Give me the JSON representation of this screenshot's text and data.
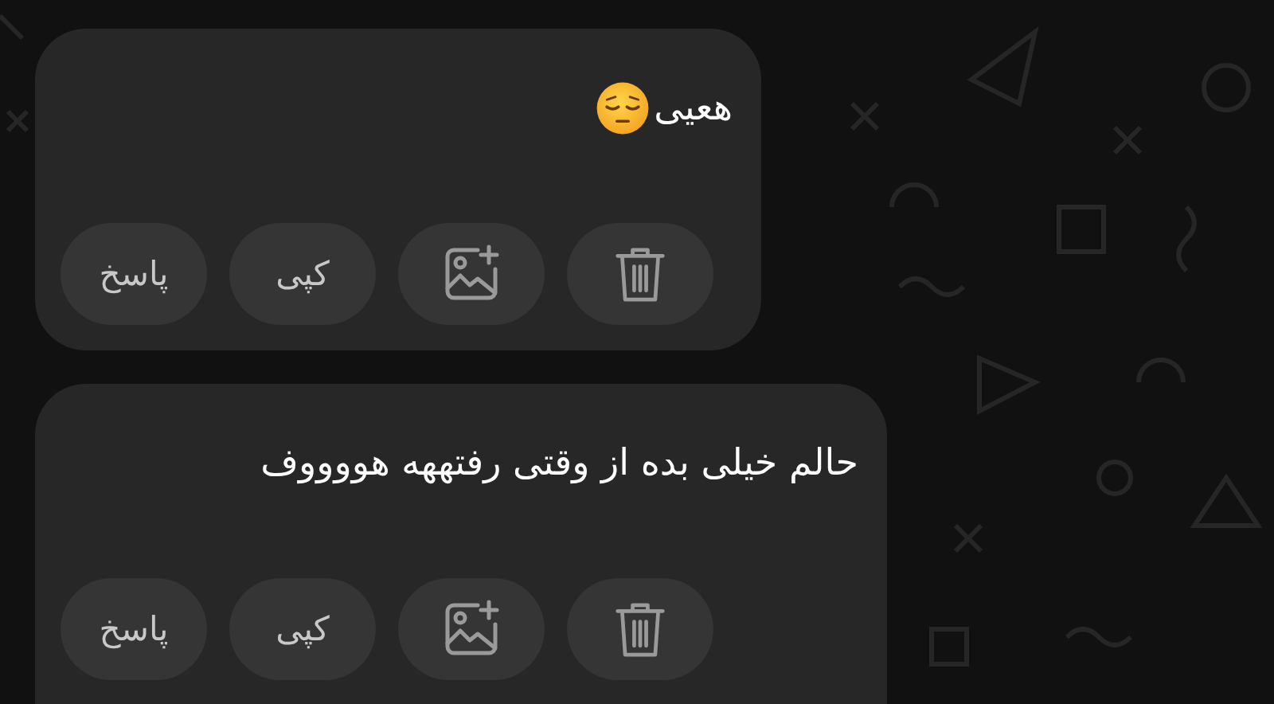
{
  "messages": [
    {
      "text": "هعیی",
      "emoji": true,
      "actions": [
        {
          "kind": "delete"
        },
        {
          "kind": "add-image"
        },
        {
          "kind": "text",
          "label": "کپی"
        },
        {
          "kind": "text",
          "label": "پاسخ"
        }
      ]
    },
    {
      "text": "حالم خیلی بده از وقتی رفتههه هووووف",
      "emoji": false,
      "actions": [
        {
          "kind": "delete"
        },
        {
          "kind": "add-image"
        },
        {
          "kind": "text",
          "label": "کپی"
        },
        {
          "kind": "text",
          "label": "پاسخ"
        }
      ]
    }
  ]
}
